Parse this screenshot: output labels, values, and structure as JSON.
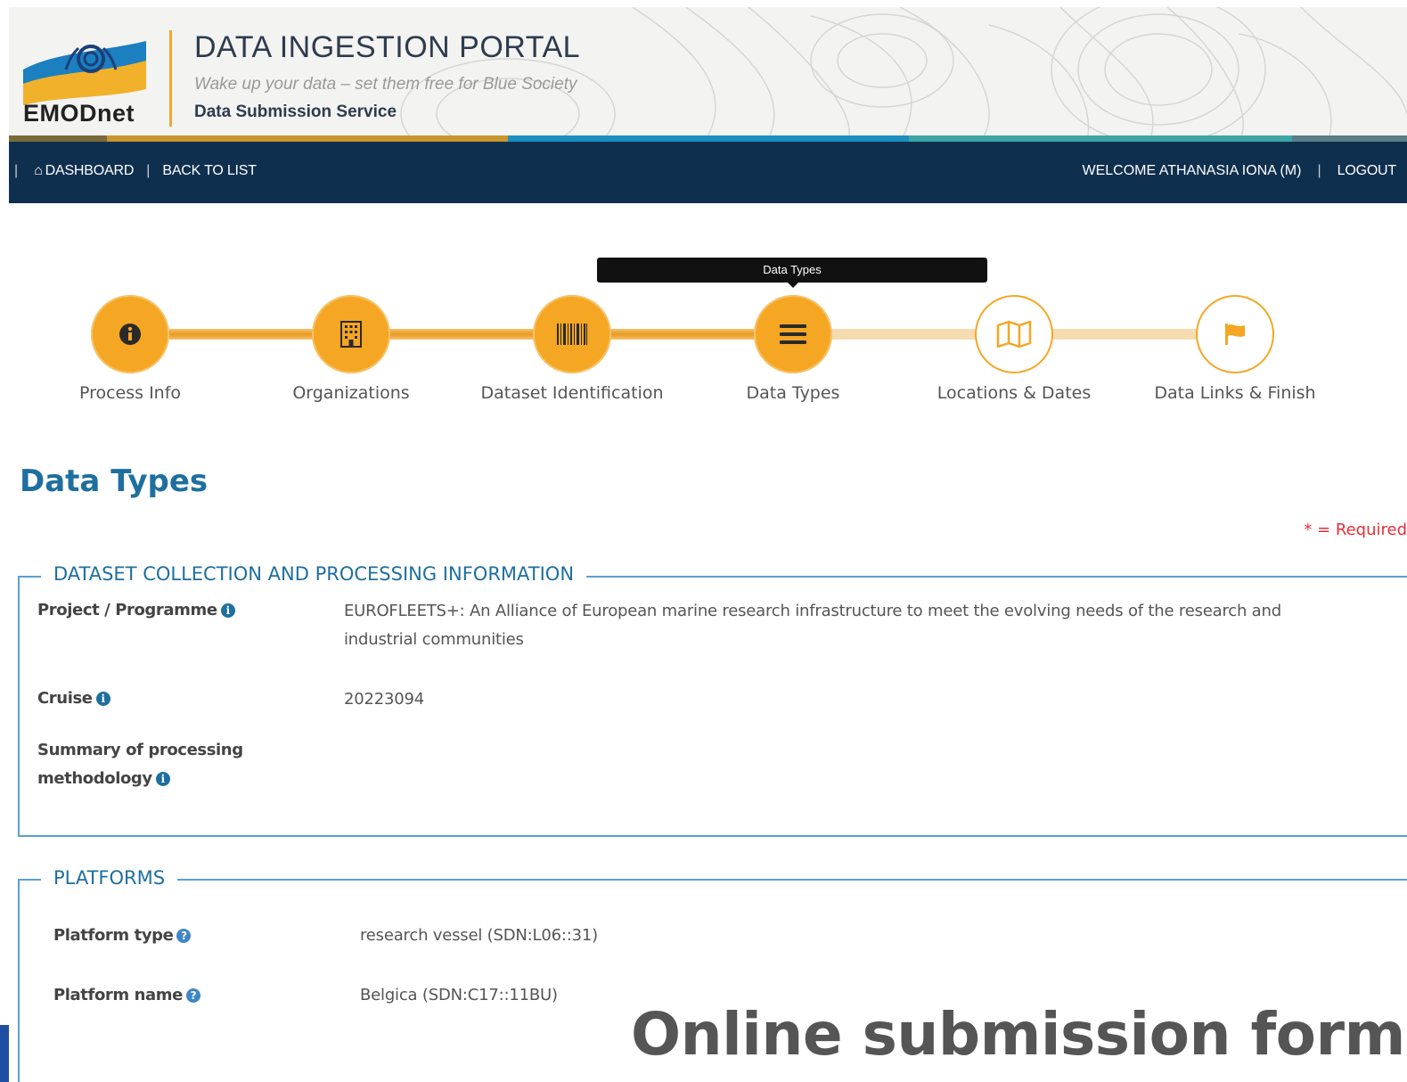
{
  "header": {
    "brand": "EMODnet",
    "title": "DATA INGESTION PORTAL",
    "tagline": "Wake up your data – set them free for Blue Society",
    "service": "Data Submission Service",
    "strip_colors": [
      "#7b6a3a",
      "#c9952e",
      "#1c8fc0",
      "#3fa6a6",
      "#5a7f86"
    ]
  },
  "nav": {
    "dashboard": "DASHBOARD",
    "back": "BACK TO LIST",
    "welcome": "WELCOME ATHANASIA IONA (M)",
    "logout": "LOGOUT",
    "separator": "|",
    "home_glyph": "⌂"
  },
  "wizard": {
    "tooltip": "Data Types",
    "steps": [
      {
        "label": "Process Info",
        "icon": "info-icon",
        "state": "done"
      },
      {
        "label": "Organizations",
        "icon": "building-icon",
        "state": "done"
      },
      {
        "label": "Dataset Identification",
        "icon": "barcode-icon",
        "state": "done"
      },
      {
        "label": "Data Types",
        "icon": "list-icon",
        "state": "current"
      },
      {
        "label": "Locations & Dates",
        "icon": "map-icon",
        "state": "todo"
      },
      {
        "label": "Data Links & Finish",
        "icon": "flag-icon",
        "state": "todo"
      }
    ],
    "accent": "#f5a623"
  },
  "page": {
    "title": "Data Types",
    "required_note": "* = Required"
  },
  "collection": {
    "legend": "DATASET COLLECTION AND PROCESSING INFORMATION",
    "project_label": "Project / Programme",
    "project_value_line1": "EUROFLEETS+: An Alliance of European marine research infrastructure to meet the evolving needs of the research and",
    "project_value_line2": "industrial communities",
    "cruise_label": "Cruise",
    "cruise_value": "20223094",
    "summary_label_line1": "Summary of processing",
    "summary_label_line2": "methodology",
    "info_glyph": "i"
  },
  "platforms": {
    "legend": "PLATFORMS",
    "type_label": "Platform type",
    "type_value": "research vessel (SDN:L06::31)",
    "name_label": "Platform name",
    "name_value": "Belgica (SDN:C17::11BU)",
    "help_glyph": "?"
  },
  "caption": "Online submission form"
}
